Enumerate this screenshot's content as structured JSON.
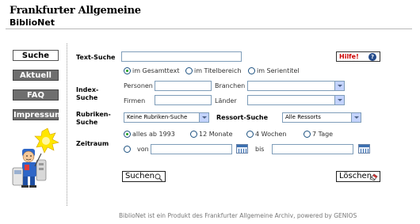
{
  "header": {
    "brand": "Frankfurter Allgemeine",
    "subbrand": "BiblioNet"
  },
  "nav": {
    "items": [
      {
        "label": "Suche"
      },
      {
        "label": "Aktuell"
      },
      {
        "label": "FAQ"
      },
      {
        "label": "Impressum"
      }
    ]
  },
  "help": {
    "label": "Hilfe!",
    "icon_glyph": "?"
  },
  "text_search": {
    "label": "Text-Suche",
    "value": "",
    "scopes": [
      "im Gesamttext",
      "im Titelbereich",
      "im Serientitel"
    ],
    "selected_scope": "im Gesamttext"
  },
  "index_search": {
    "label_1": "Index-",
    "label_2": "Suche",
    "personen": {
      "label": "Personen",
      "value": ""
    },
    "branchen": {
      "label": "Branchen",
      "value": ""
    },
    "firmen": {
      "label": "Firmen",
      "value": ""
    },
    "laender": {
      "label": "Länder",
      "value": ""
    }
  },
  "rubrik_search": {
    "label_1": "Rubriken-",
    "label_2": "Suche",
    "value": "Keine Rubriken-Suche"
  },
  "ressort_search": {
    "label": "Ressort-Suche",
    "value": "Alle Ressorts"
  },
  "zeitraum": {
    "label": "Zeitraum",
    "options": [
      "alles ab 1993",
      "12 Monate",
      "4 Wochen",
      "7 Tage"
    ],
    "selected": "alles ab 1993",
    "von_label": "von",
    "bis_label": "bis",
    "von_value": "",
    "bis_value": ""
  },
  "buttons": {
    "search": "Suchen",
    "clear": "Löschen"
  },
  "footer": "BiblioNet ist ein Produkt des Frankfurter Allgemeine Archiv, powered by GENIOS",
  "colors": {
    "help_text": "#cc0000",
    "nav_dark": "#6e6e6e",
    "radio_selected": "#21a121",
    "input_border": "#7f9db9"
  }
}
